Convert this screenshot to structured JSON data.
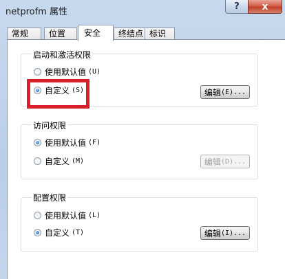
{
  "window": {
    "title": "netprofm 属性"
  },
  "titlebar": {
    "help_glyph": "?",
    "close_glyph": "x"
  },
  "tabs": [
    {
      "label": "常规"
    },
    {
      "label": "位置"
    },
    {
      "label": "安全"
    },
    {
      "label": "终结点"
    },
    {
      "label": "标识"
    }
  ],
  "groups": {
    "launch": {
      "title": "启动和激活权限",
      "opt_default": "使用默认值",
      "opt_default_key": "(U)",
      "opt_custom": "自定义",
      "opt_custom_key": "(S)",
      "edit_label": "编辑",
      "edit_key": "(E)...",
      "selected": "custom"
    },
    "access": {
      "title": "访问权限",
      "opt_default": "使用默认值",
      "opt_default_key": "(F)",
      "opt_custom": "自定义",
      "opt_custom_key": "(M)",
      "edit_label": "编辑",
      "edit_key": "(D)...",
      "selected": "default"
    },
    "config": {
      "title": "配置权限",
      "opt_default": "使用默认值",
      "opt_default_key": "(L)",
      "opt_custom": "自定义",
      "opt_custom_key": "(T)",
      "edit_label": "编辑",
      "edit_key": "(I)...",
      "selected": "custom"
    }
  },
  "colors": {
    "highlight_box": "#d9202a",
    "window_frame": "#b9cfe8"
  }
}
